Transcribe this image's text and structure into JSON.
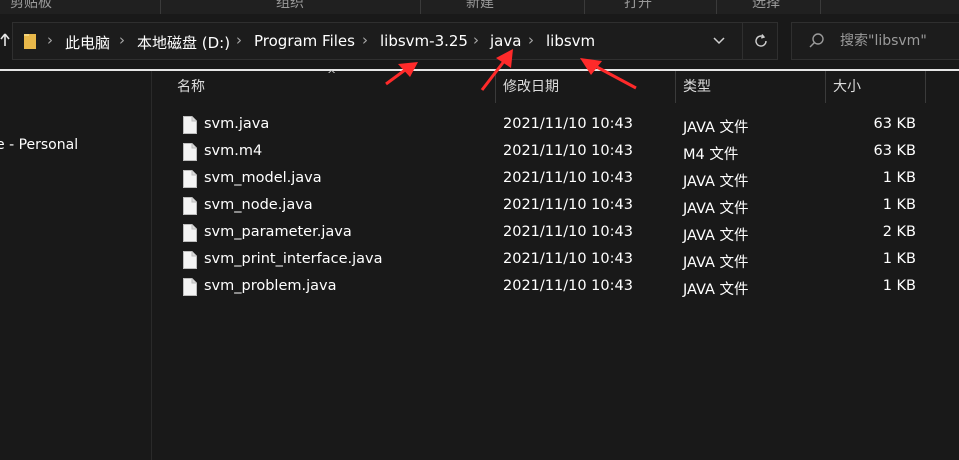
{
  "ribbon": {
    "groups": [
      "剪贴板",
      "组织",
      "新建",
      "打开",
      "选择"
    ]
  },
  "address_bar": {
    "crumbs": [
      "此电脑",
      "本地磁盘 (D:)",
      "Program Files",
      "libsvm-3.25",
      "java",
      "libsvm"
    ]
  },
  "search": {
    "placeholder": "搜索\"libsvm\""
  },
  "nav_pane": {
    "items": [
      "e - Personal"
    ]
  },
  "columns": {
    "name": "名称",
    "date": "修改日期",
    "type": "类型",
    "size": "大小"
  },
  "files": [
    {
      "name": "svm.java",
      "date": "2021/11/10 10:43",
      "type": "JAVA 文件",
      "size": "63 KB"
    },
    {
      "name": "svm.m4",
      "date": "2021/11/10 10:43",
      "type": "M4 文件",
      "size": "63 KB"
    },
    {
      "name": "svm_model.java",
      "date": "2021/11/10 10:43",
      "type": "JAVA 文件",
      "size": "1 KB"
    },
    {
      "name": "svm_node.java",
      "date": "2021/11/10 10:43",
      "type": "JAVA 文件",
      "size": "1 KB"
    },
    {
      "name": "svm_parameter.java",
      "date": "2021/11/10 10:43",
      "type": "JAVA 文件",
      "size": "2 KB"
    },
    {
      "name": "svm_print_interface.java",
      "date": "2021/11/10 10:43",
      "type": "JAVA 文件",
      "size": "1 KB"
    },
    {
      "name": "svm_problem.java",
      "date": "2021/11/10 10:43",
      "type": "JAVA 文件",
      "size": "1 KB"
    }
  ],
  "colors": {
    "background": "#191919",
    "annotation_arrow": "#ff2a2a",
    "folder": "#e8b84a"
  },
  "icons": [
    "folder-icon",
    "chevron-right-icon",
    "chevron-down-icon",
    "refresh-icon",
    "search-icon",
    "file-icon",
    "up-arrow-icon"
  ]
}
